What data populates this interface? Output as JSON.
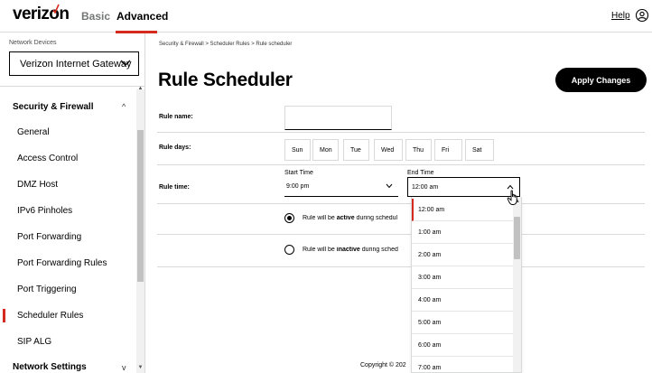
{
  "header": {
    "logo_text": "verizon",
    "nav": {
      "basic": "Basic",
      "advanced": "Advanced"
    },
    "help": "Help"
  },
  "sidebar": {
    "device_label": "Network Devices",
    "device_selected": "Verizon Internet Gateway",
    "group_security": "Security & Firewall",
    "items": [
      {
        "label": "General"
      },
      {
        "label": "Access Control"
      },
      {
        "label": "DMZ Host"
      },
      {
        "label": "IPv6 Pinholes"
      },
      {
        "label": "Port Forwarding"
      },
      {
        "label": "Port Forwarding Rules"
      },
      {
        "label": "Port Triggering"
      },
      {
        "label": "Scheduler Rules",
        "active": true
      },
      {
        "label": "SIP ALG"
      }
    ],
    "group_network": "Network Settings"
  },
  "main": {
    "breadcrumb": "Security & Firewall  >  Scheduler Rules  >  Rule scheduler",
    "title": "Rule Scheduler",
    "apply_button": "Apply Changes",
    "rule_name_label": "Rule name:",
    "rule_name_value": "",
    "rule_days_label": "Rule days:",
    "days": [
      "Sun",
      "Mon",
      "Tue",
      "Wed",
      "Thu",
      "Fri",
      "Sat"
    ],
    "rule_time_label": "Rule time:",
    "start_time_label": "Start Time",
    "start_time_value": "9:00 pm",
    "end_time_label": "End Time",
    "end_time_value": "12:00 am",
    "radio_active_pre": "Rule will be ",
    "radio_active_bold": "active",
    "radio_active_post": " during schedul",
    "radio_inactive_pre": "Rule will be ",
    "radio_inactive_bold": "inactive",
    "radio_inactive_post": " during sched",
    "active_selected": true,
    "copyright": "Copyright © 202"
  },
  "end_time_dropdown": {
    "options": [
      "12:00 am",
      "1:00 am",
      "2:00 am",
      "3:00 am",
      "4:00 am",
      "5:00 am",
      "6:00 am",
      "7:00 am"
    ],
    "selected": "12:00 am"
  },
  "colors": {
    "brand_red": "#d52b1e",
    "border_gray": "#d8dada",
    "button_black": "#000000"
  }
}
